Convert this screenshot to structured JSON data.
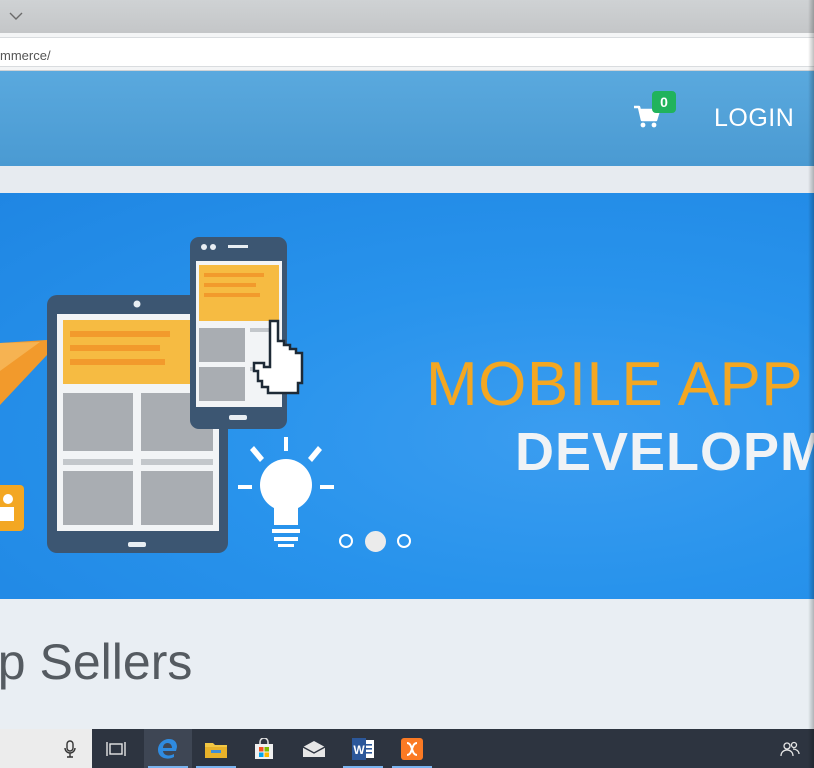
{
  "browser": {
    "url": "mmerce/"
  },
  "navbar": {
    "cart_count": "0",
    "login_label": "LOGIN"
  },
  "hero": {
    "headline_line1": "MOBILE APP",
    "headline_line2": "DEVELOPM",
    "slides_total": 3,
    "active_slide": 2
  },
  "section": {
    "title": "op Sellers"
  },
  "taskbar": {
    "icons": [
      "microphone-icon",
      "task-view-icon",
      "edge-icon",
      "file-explorer-icon",
      "store-icon",
      "mail-icon",
      "word-icon",
      "xampp-icon",
      "people-icon"
    ]
  },
  "colors": {
    "navbar": "#4a9ad2",
    "hero": "#2893ec",
    "headline_orange": "#f3a722",
    "badge_green": "#21b35c",
    "taskbar": "#2d3440"
  }
}
